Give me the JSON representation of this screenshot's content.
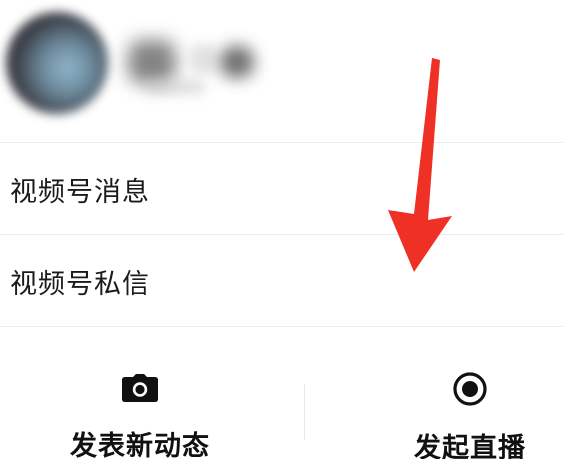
{
  "menu": {
    "items": [
      {
        "label": "视频号消息"
      },
      {
        "label": "视频号私信"
      }
    ]
  },
  "actions": {
    "post": {
      "label": "发表新动态",
      "icon": "camera-icon"
    },
    "live": {
      "label": "发起直播",
      "icon": "record-icon"
    }
  },
  "colors": {
    "annotation": "#ee3124",
    "text": "#1b1b1b",
    "divider": "#ececec"
  }
}
